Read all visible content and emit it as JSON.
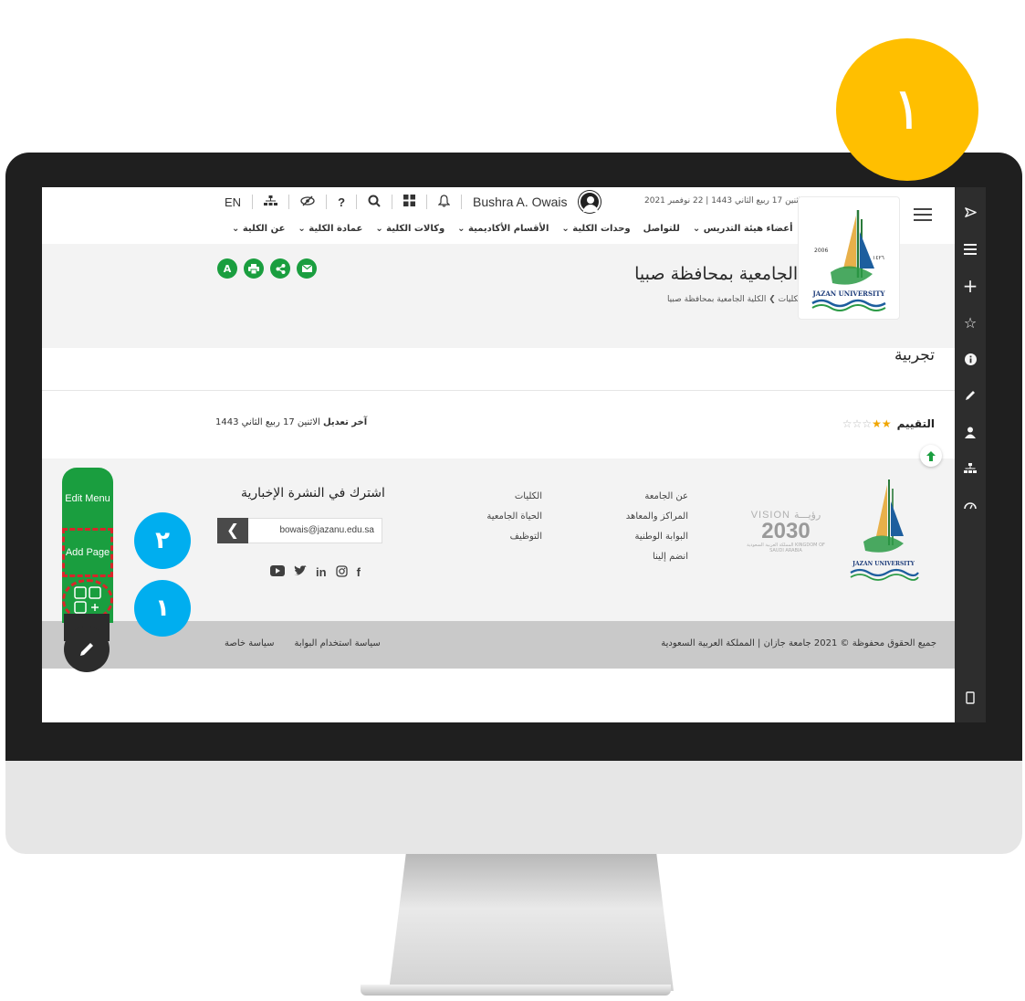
{
  "step_badges": {
    "main": "١",
    "add_page": "٢",
    "grid": "١"
  },
  "topbar": {
    "lang": "EN",
    "icons": [
      "sitemap-icon",
      "eye-slash-icon",
      "help-icon",
      "search-icon",
      "apps-icon",
      "bell-icon"
    ],
    "question_mark": "?",
    "user_name": "Bushra A. Owais",
    "date": "الاثنين 17 ربيع الثاني 1443 | 22 نوفمبر 2021"
  },
  "nav": {
    "items": [
      "عن الكلية ⌄",
      "عمادة الكلية ⌄",
      "وكالات الكلية ⌄",
      "الأقسام الأكاديمية ⌄",
      "وحدات الكلية ⌄",
      "للتواصل",
      "أعضاء هيئة التدريس ⌄"
    ]
  },
  "hero": {
    "title": "الكلية الجامعية بمحافظة صبيا",
    "breadcrumb": "الرئيسية ❯ الكليات ❯ الكلية الجامعية بمحافظة صبيا",
    "action_buttons": [
      "A",
      "print-icon",
      "share-icon",
      "mail-icon"
    ]
  },
  "page": {
    "heading": "تجربية",
    "rating_label": "التقييم",
    "rating_value": 2,
    "rating_max": 5,
    "modified_label": "آخر تعديل",
    "modified_date": "الاثنين 17 ربيع الثاني 1443"
  },
  "footer": {
    "col_university": [
      "عن الجامعة",
      "المراكز والمعاهد",
      "البوابة الوطنية",
      "انضم إلينا"
    ],
    "col_colleges": [
      "الكليات",
      "الحياة الجامعية",
      "التوظيف"
    ],
    "newsletter_title": "اشترك في النشرة الإخبارية",
    "newsletter_email": "bowais@jazanu.edu.sa",
    "social": [
      "youtube-icon",
      "twitter-icon",
      "linkedin-icon",
      "instagram-icon",
      "facebook-icon"
    ],
    "vision_top": "VISION رؤيـــة",
    "vision_year": "2030",
    "vision_sub": "المملكة العربية السعودية KINGDOM OF SAUDI ARABIA",
    "copyright": "جميع الحقوق محفوظة © 2021 جامعة جازان | المملكة العربية السعودية",
    "policy_links": [
      "سياسة استخدام البوابة",
      "سياسة خاصة"
    ]
  },
  "editor_panel": {
    "edit_menu": "Edit Menu",
    "add_page": "Add Page"
  },
  "logo": {
    "text": "JAZAN UNIVERSITY",
    "year_left": "2006",
    "year_right": "١٤٢٦"
  },
  "colors": {
    "green": "#1a9e3f",
    "yellow_badge": "#ffbf00",
    "blue_badge": "#00aeef",
    "dashed_highlight": "#d9252a"
  }
}
